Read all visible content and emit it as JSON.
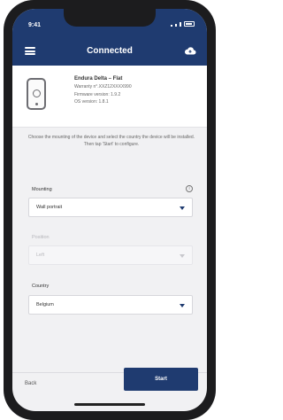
{
  "status_bar": {
    "time": "9:41"
  },
  "header": {
    "title": "Connected",
    "menu_icon": "menu-icon",
    "cloud_icon": "cloud-icon"
  },
  "device": {
    "name": "Endura Delta – Flat",
    "warranty": "Warranty n°.XXZ12XXXX990",
    "firmware": "Firmware version: 1.9.2",
    "os": "OS version: 1.8.1",
    "icon": "device-icon"
  },
  "instructions": "Choose the mounting of the device and select the country the device will be installed. Then tap 'Start' to configure.",
  "fields": {
    "mounting": {
      "label": "Mounting",
      "value": "Wall portrait"
    },
    "position": {
      "label": "Position",
      "value": "Left"
    },
    "country": {
      "label": "Country",
      "value": "Belgium"
    }
  },
  "footer": {
    "back_label": "Back",
    "start_label": "Start"
  },
  "colors": {
    "brand": "#1f3b70",
    "background": "#f1f1f3"
  }
}
